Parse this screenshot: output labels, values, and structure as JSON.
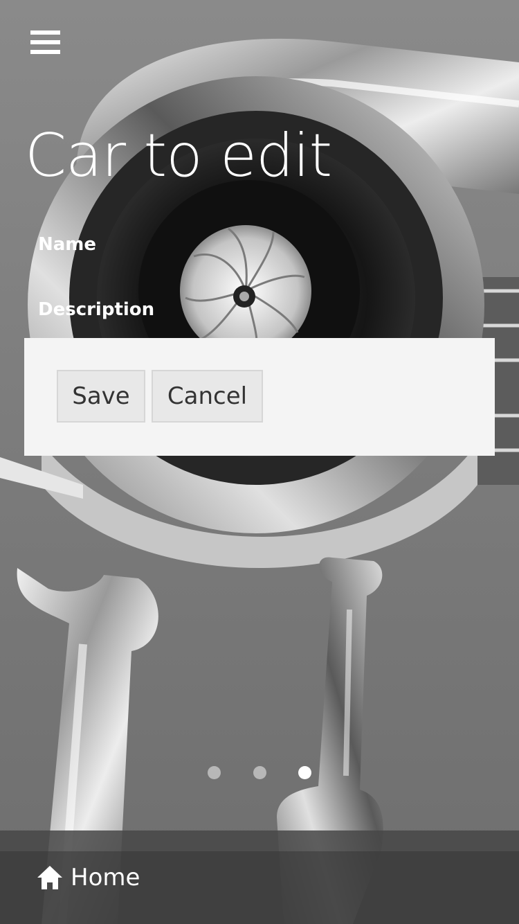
{
  "header": {
    "menu_icon": "hamburger-menu-icon",
    "title": "Car to edit"
  },
  "form": {
    "name_label": "Name",
    "description_label": "Description"
  },
  "actions": {
    "save_label": "Save",
    "cancel_label": "Cancel"
  },
  "pager": {
    "count": 3,
    "active_index": 2
  },
  "footer": {
    "home_icon": "home-icon",
    "home_label": "Home"
  },
  "colors": {
    "panel_background": "#f4f4f4",
    "button_background": "#e8e8e8",
    "footer_background": "#3c3c3c",
    "title_text": "#ffffff"
  }
}
